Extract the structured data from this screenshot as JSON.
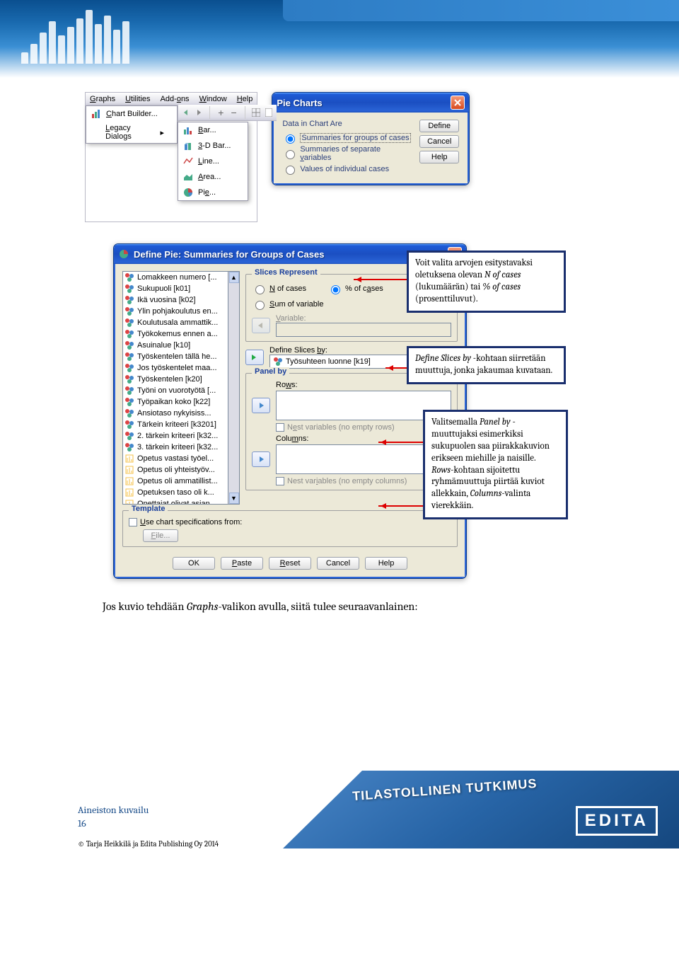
{
  "menubar": {
    "graphs": "Graphs",
    "utilities": "Utilities",
    "addons": "Add-ons",
    "window": "Window",
    "help": "Help"
  },
  "menu1": {
    "chartbuilder": "Chart Builder...",
    "legacy": "Legacy Dialogs",
    "arrow": "▸"
  },
  "submenu": {
    "bar": "Bar...",
    "bar3d": "3-D Bar...",
    "line": "Line...",
    "area": "Area...",
    "pie": "Pie..."
  },
  "pie_dlg": {
    "title": "Pie Charts",
    "section": "Data in Chart Are",
    "r1": "Summaries for groups of cases",
    "r2": "Summaries of separate variables",
    "r3": "Values of individual cases",
    "btn_define": "Define",
    "btn_cancel": "Cancel",
    "btn_help": "Help"
  },
  "define": {
    "title": "Define Pie: Summaries for Groups of Cases",
    "vars": [
      "Lomakkeen numero [...",
      "Sukupuoli [k01]",
      "Ikä vuosina [k02]",
      "Ylin pohjakoulutus en...",
      "Koulutusala ammattik...",
      "Työkokemus ennen a...",
      "Asuinalue [k10]",
      "Työskentelen tällä he...",
      "Jos työskentelet maa...",
      "Työskentelen [k20]",
      "Työni on vuorotyötä [...",
      "Työpaikan koko [k22]",
      "Ansiotaso nykyisiss...",
      "Tärkein kriteeri [k3201]",
      "2. tärkein kriteeri [k32...",
      "3. tärkein kriteeri [k32...",
      "Opetus vastasi työel...",
      "Opetus oli yhteistyöv...",
      "Opetus oli ammatillist...",
      "Opetuksen taso oli k...",
      "Opettajat olivat asian..."
    ],
    "slices": "Slices Represent",
    "n_of_cases": "N of cases",
    "pct_of_cases": "% of cases",
    "sum_var": "Sum of variable",
    "variable": "Variable:",
    "define_slices": "Define Slices by:",
    "slice_var": "Työsuhteen luonne [k19]",
    "panel_by": "Panel by",
    "rows": "Rows:",
    "cols": "Columns:",
    "nest_rows": "Nest variables (no empty rows)",
    "nest_cols": "Nest variables (no empty columns)",
    "template": "Template",
    "use_spec": "Use chart specifications from:",
    "file": "File...",
    "ok": "OK",
    "paste": "Paste",
    "reset": "Reset",
    "cancel": "Cancel",
    "help": "Help",
    "underline_u": "U"
  },
  "callouts": {
    "c1": "Voit valita arvojen esitystavaksi oletuksena olevan N of cases (lukumäärän) tai % of cases (prosenttiluvut).",
    "c1_html": "Voit valita arvojen esitystavaksi oletuksena olevan <em>N of cases</em> (lukumäärän) tai <em>% of cases</em> (prosenttiluvut).",
    "c2_html": "<em>Define Slices by</em> -kohtaan siirretään muuttuja, jonka jakaumaa kuvataan.",
    "c3_html": "Valitsemalla <em>Panel by</em> -muuttujaksi esimerkiksi sukupuolen saa piirakkakuvion erikseen miehille ja naisille. <em>Rows</em>-kohtaan sijoitettu ryhmämuuttuja piirtää kuviot allekkain, <em>Columns</em>-valinta vierekkäin."
  },
  "bodytext": "Jos kuvio tehdään Graphs-valikon avulla, siitä tulee seuraavanlainen:",
  "bodytext_html": "Jos kuvio tehdään <em>Graphs</em>-valikon avulla, siitä tulee seuraavanlainen:",
  "footer": {
    "section": "Aineiston kuvailu",
    "page": "16",
    "copy": "© Tarja Heikkilä ja Edita Publishing Oy 2014",
    "brand": "TILASTOLLINEN TUTKIMUS",
    "logo": "EDITA"
  }
}
